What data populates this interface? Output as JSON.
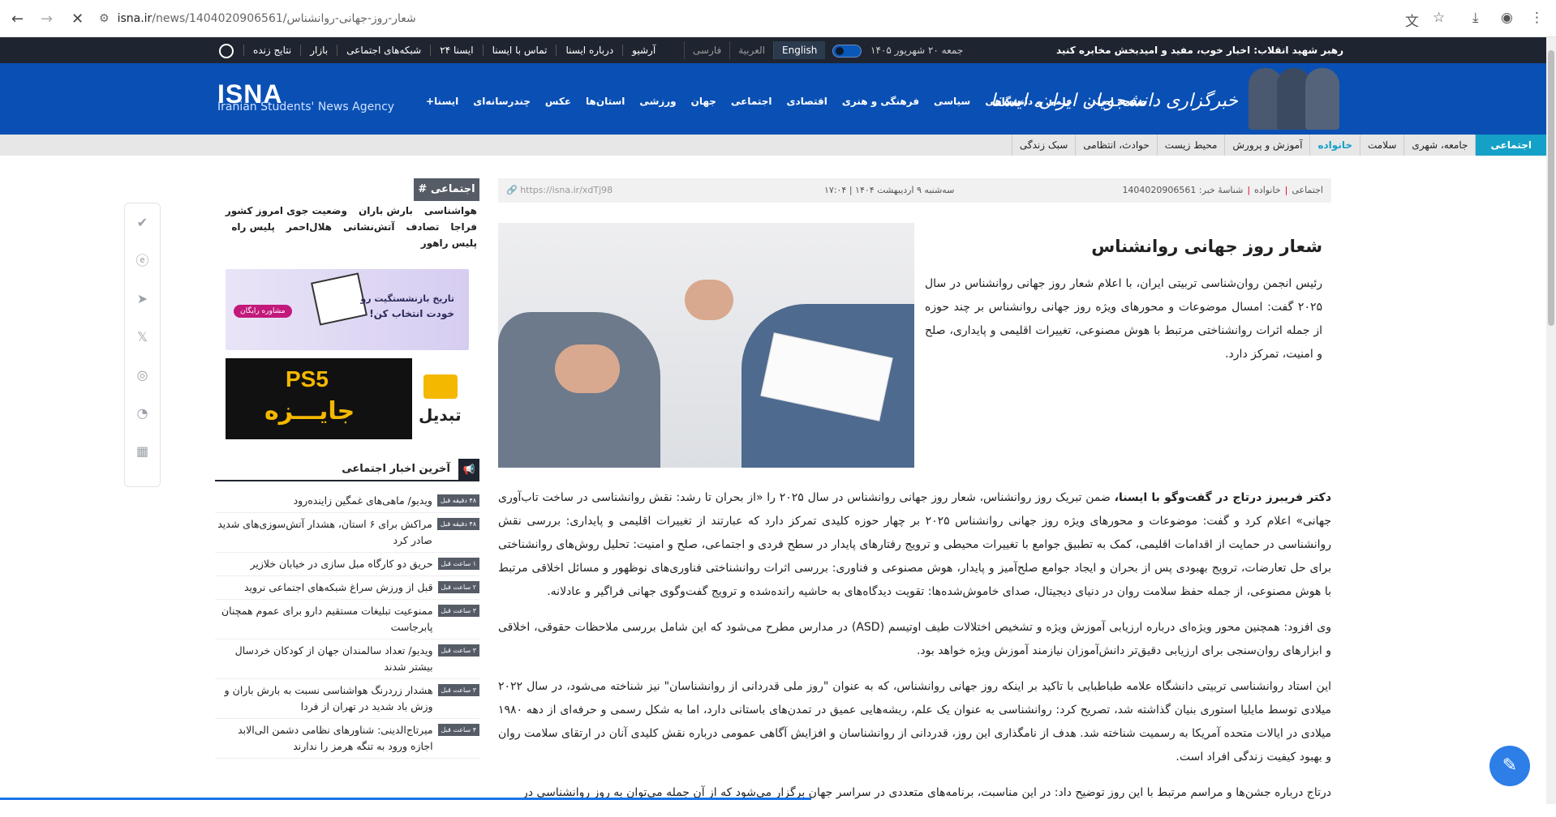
{
  "browser": {
    "url_host": "isna.ir",
    "url_path": "/news/1404020906561/شعار-روز-جهانی-روانشناس"
  },
  "topbar": {
    "slogan": "رهبر شهید انقلاب: اخبار خوب، مفید و امیدبخش مخابره کنید",
    "date": "جمعه ۲۰ شهریور ۱۴۰۵",
    "langs": [
      "فارسی",
      "العربية",
      "English"
    ],
    "links": [
      "آرشیو",
      "درباره ایسنا",
      "تماس با ایسنا",
      "ایسنا ۲۴",
      "شبکه‌های اجتماعی",
      "بازار",
      "نتایج زنده"
    ]
  },
  "header": {
    "logo": "ISNA",
    "logo_sub": "Iranian Students' News Agency",
    "brand": "خبرگزاری دانشجویان ایران، ایسنا",
    "nav": [
      "صفحه اصلی",
      "علمی و دانشگاهی",
      "سیاسی",
      "فرهنگی و هنری",
      "اقتصادی",
      "اجتماعی",
      "جهان",
      "ورزشی",
      "استان‌ها",
      "عکس",
      "چندرسانه‌ای",
      "ایسنا+"
    ]
  },
  "subnav": {
    "items": [
      "اجتماعی",
      "جامعه، شهری",
      "سلامت",
      "خانواده",
      "آموزش و پرورش",
      "محیط زیست",
      "حوادث، انتظامی",
      "سبک زندگی"
    ]
  },
  "sidebar": {
    "tag_title": "# اجتماعی",
    "tags": [
      "هواشناسی",
      "بارش باران",
      "وضعیت جوی امروز کشور",
      "فراجا",
      "تصادف",
      "آتش‌نشانی",
      "هلال‌احمر",
      "پلیس راه",
      "پلیس راهور"
    ],
    "ad1_line1": "تاریخ بازنشستگیت رو",
    "ad1_line2": "خودت انتخاب کن!",
    "ad1_button": "مشاوره رایگان",
    "ad2_ps": "PS5",
    "ad2_prize": "جایـــزه",
    "ad2_brand": "تبدیل",
    "latest_title": "آخرین اخبار اجتماعی",
    "news": [
      {
        "badge": "۴۸ دقیقه قبل",
        "text": "ویدیو/ ماهی‌های غمگین زاینده‌رود"
      },
      {
        "badge": "۴۸ دقیقه قبل",
        "text": "مراکش برای ۶ استان، هشدار آتش‌سوزی‌های شدید صادر کرد"
      },
      {
        "badge": "۱ ساعت قبل",
        "text": "حریق دو کارگاه مبل سازی در خیابان خلازیر"
      },
      {
        "badge": "۲ ساعت قبل",
        "text": "قبل از ورزش سراغ شبکه‌های اجتماعی نروید"
      },
      {
        "badge": "۳ ساعت قبل",
        "text": "ممنوعیت تبلیغات مستقیم دارو برای عموم همچنان پابرجاست"
      },
      {
        "badge": "۳ ساعت قبل",
        "text": "ویدیو/ تعداد سالمندان جهان از کودکان خردسال بیشتر شدند"
      },
      {
        "badge": "۳ ساعت قبل",
        "text": "هشدار زردرنگ هواشناسی نسبت به بارش باران و وزش باد شدید در تهران از فردا"
      },
      {
        "badge": "۴ ساعت قبل",
        "text": "میرتاج‌الدینی: شناورهای نظامی دشمن الی‌الابد اجازه ورود به تنگه هرمز را ندارند"
      }
    ]
  },
  "article": {
    "meta_section": "اجتماعی",
    "meta_sub": "خانواده",
    "meta_id": "شناسهٔ خبر: 1404020906561",
    "meta_date": "سه‌شنبه ۹ اردیبهشت ۱۴۰۴ | ۱۷:۰۴",
    "meta_link": "https://isna.ir/xdTj98",
    "title": "شعار روز جهانی روانشناس",
    "lead": "رئیس انجمن روان‌شناسی تربیتی ایران، با اعلام شعار روز جهانی روانشناس در سال ۲۰۲۵ گفت: امسال موضوعات و محورهای ویژه روز جهانی روانشناس بر چند حوزه از جمله اثرات روانشناختی مرتبط با هوش مصنوعی، تغییرات اقلیمی و پایداری، صلح و امنیت، تمرکز دارد.",
    "p1_bold": "دکتر فریبرز درتاج در گفت‌وگو با ایسنا،",
    "p1": " ضمن تبریک روز روانشناس، شعار روز جهانی روانشناس در سال ۲۰۲۵ را «از بحران تا رشد: نقش روانشناسی در ساخت تاب‌آوری جهانی» اعلام کرد و گفت: موضوعات و محورهای ویژه روز جهانی روانشناس ۲۰۲۵ بر چهار حوزه کلیدی تمرکز دارد که عبارتند از تغییرات اقلیمی و پایداری: بررسی نقش روانشناسی در حمایت از اقدامات اقلیمی، کمک به تطبیق جوامع با تغییرات محیطی و ترویج رفتارهای پایدار در سطح فردی و اجتماعی، صلح و امنیت: تحلیل روش‌های روانشناختی برای حل تعارضات، ترویج بهبودی پس از بحران و ایجاد جوامع صلح‌آمیز و پایدار، هوش مصنوعی و فناوری: بررسی اثرات روانشناختی فناوری‌های نوظهور و مسائل اخلاقی مرتبط با هوش مصنوعی، از جمله حفظ سلامت روان در دنیای دیجیتال، صدای خاموش‌شده‌ها: تقویت دیدگاه‌های به حاشیه رانده‌شده و ترویج گفت‌وگوی جهانی فراگیر و عادلانه.",
    "p2": "وی افزود: همچنین محور ویژه‌ای درباره ارزیابی آموزش ویژه و تشخیص اختلالات طیف اوتیسم (ASD) در مدارس مطرح می‌شود که این شامل بررسی ملاحظات حقوقی، اخلاقی و ابزارهای روان‌سنجی برای ارزیابی دقیق‌تر دانش‌آموزان نیازمند آموزش ویژه خواهد بود.",
    "p3": "این استاد روانشناسی تربیتی دانشگاه علامه طباطبایی با تاکید بر اینکه روز جهانی روانشناس، که به عنوان \"روز ملی قدردانی از روانشناسان\" نیز شناخته می‌شود، در سال ۲۰۲۲ میلادی توسط مایلیا استوری بنیان گذاشته شد، تصریح کرد: روانشناسی به عنوان یک علم، ریشه‌هایی عمیق در تمدن‌های باستانی دارد، اما به شکل رسمی و حرفه‌ای از دهه ۱۹۸۰ میلادی در ایالات متحده آمریکا به رسمیت شناخته شد. هدف از نامگذاری این روز، قدردانی از روانشناسان و افزایش آگاهی عمومی درباره نقش کلیدی آنان در ارتقای سلامت روان و بهبود کیفیت زندگی افراد است.",
    "p4": "درتاج درباره جشن‌ها و مراسم مرتبط با این روز توضیح داد: در این مناسبت، برنامه‌های متعددی در سراسر جهان برگزار می‌شود که از آن جمله می‌توان به روز روانشناسی در"
  },
  "colors": {
    "header_blue": "#0a50b4",
    "topbar_dark": "#1f2530",
    "accent_teal": "#15a0c8"
  }
}
